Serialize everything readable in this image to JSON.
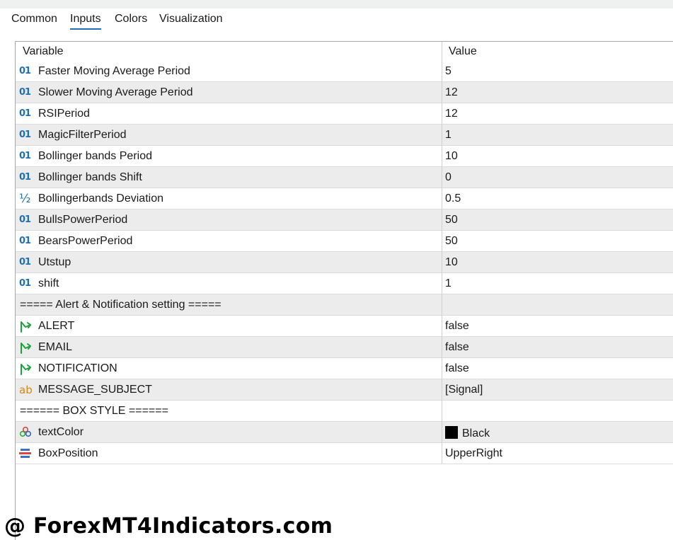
{
  "tabs": [
    {
      "label": "Common"
    },
    {
      "label": "Inputs"
    },
    {
      "label": "Colors"
    },
    {
      "label": "Visualization"
    }
  ],
  "active_tab": "Inputs",
  "table": {
    "headers": {
      "variable": "Variable",
      "value": "Value"
    },
    "rows": [
      {
        "icon": "integer-icon",
        "name": "Faster Moving Average Period",
        "value": "5"
      },
      {
        "icon": "integer-icon",
        "name": "Slower Moving Average Period",
        "value": "12"
      },
      {
        "icon": "integer-icon",
        "name": "RSIPeriod",
        "value": "12"
      },
      {
        "icon": "integer-icon",
        "name": "MagicFilterPeriod",
        "value": "1"
      },
      {
        "icon": "integer-icon",
        "name": "Bollinger bands Period",
        "value": "10"
      },
      {
        "icon": "integer-icon",
        "name": "Bollinger bands Shift",
        "value": "0"
      },
      {
        "icon": "double-icon",
        "name": "Bollingerbands Deviation",
        "value": "0.5"
      },
      {
        "icon": "integer-icon",
        "name": "BullsPowerPeriod",
        "value": "50"
      },
      {
        "icon": "integer-icon",
        "name": "BearsPowerPeriod",
        "value": "50"
      },
      {
        "icon": "integer-icon",
        "name": "Utstup",
        "value": "10"
      },
      {
        "icon": "integer-icon",
        "name": "shift",
        "value": "1"
      },
      {
        "icon": "",
        "name": "===== Alert & Notification setting =====",
        "value": ""
      },
      {
        "icon": "boolean-icon",
        "name": "ALERT",
        "value": "false"
      },
      {
        "icon": "boolean-icon",
        "name": "EMAIL",
        "value": "false"
      },
      {
        "icon": "boolean-icon",
        "name": "NOTIFICATION",
        "value": "false"
      },
      {
        "icon": "string-icon",
        "name": "MESSAGE_SUBJECT",
        "value": "[Signal]"
      },
      {
        "icon": "",
        "name": "====== BOX STYLE ======",
        "value": ""
      },
      {
        "icon": "color-icon",
        "name": "textColor",
        "value": "Black",
        "swatch": "#000000"
      },
      {
        "icon": "enum-icon",
        "name": "BoxPosition",
        "value": "UpperRight"
      }
    ]
  },
  "icons": {
    "integer": "01",
    "double": "½",
    "string": "ab"
  },
  "colors": {
    "accent": "#1f6fb5",
    "bool_icon": "#1aa33a",
    "string_icon": "#d48a1a",
    "alt_row": "#ececec"
  },
  "watermark": "@ ForexMT4Indicators.com"
}
